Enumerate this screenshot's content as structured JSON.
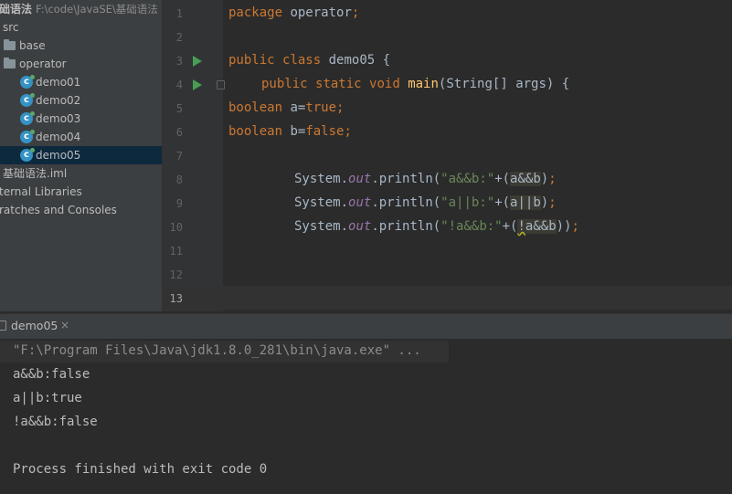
{
  "project": {
    "root_name": "础语法",
    "root_path": "F:\\code\\JavaSE\\基础语法",
    "items": [
      {
        "label": "src"
      },
      {
        "label": "base"
      },
      {
        "label": "operator"
      },
      {
        "label": "demo01"
      },
      {
        "label": "demo02"
      },
      {
        "label": "demo03"
      },
      {
        "label": "demo04"
      },
      {
        "label": "demo05"
      },
      {
        "label": "基础语法.iml"
      },
      {
        "label": "ternal Libraries"
      },
      {
        "label": "ratches and Consoles"
      }
    ]
  },
  "editor": {
    "line_numbers": [
      "1",
      "2",
      "3",
      "4",
      "5",
      "6",
      "7",
      "8",
      "9",
      "10",
      "11",
      "12",
      "13"
    ],
    "lines": [
      {
        "package_kw": "package",
        "package_name": " operator",
        "semi": ";"
      },
      {},
      {
        "kw1": "public",
        "kw2": "class",
        "name": " demo05 {"
      },
      {
        "kw1": "public",
        "kw2": "static",
        "kw3": "void",
        "fn": "main",
        "rest": "(String[] args) {"
      },
      {
        "type": "boolean",
        "rest": " a=",
        "val": "true",
        "semi": ";"
      },
      {
        "type": "boolean",
        "rest": " b=",
        "val": "false",
        "semi": ";"
      },
      {},
      {
        "sys": "System.",
        "out": "out",
        "call": ".println(",
        "str": "\"a&&b:\"",
        "plus": "+(",
        "expr": "a&&b",
        "end": ")",
        "semi": ";"
      },
      {
        "sys": "System.",
        "out": "out",
        "call": ".println(",
        "str": "\"a||b:\"",
        "plus": "+(",
        "expr": "a||b",
        "end": ")",
        "semi": ";"
      },
      {
        "sys": "System.",
        "out": "out",
        "call": ".println(",
        "str": "\"!a&&b:\"",
        "plus": "+(",
        "expr_bang": "!",
        "expr": "a&&b",
        "end": "))",
        "semi": ";"
      }
    ]
  },
  "run_tab": {
    "label": "demo05",
    "close": "×"
  },
  "console": {
    "command": "\"F:\\Program Files\\Java\\jdk1.8.0_281\\bin\\java.exe\" ...",
    "out1": "a&&b:false",
    "out2": "a||b:true",
    "out3": "!a&&b:false",
    "exit": "Process finished with exit code 0"
  }
}
